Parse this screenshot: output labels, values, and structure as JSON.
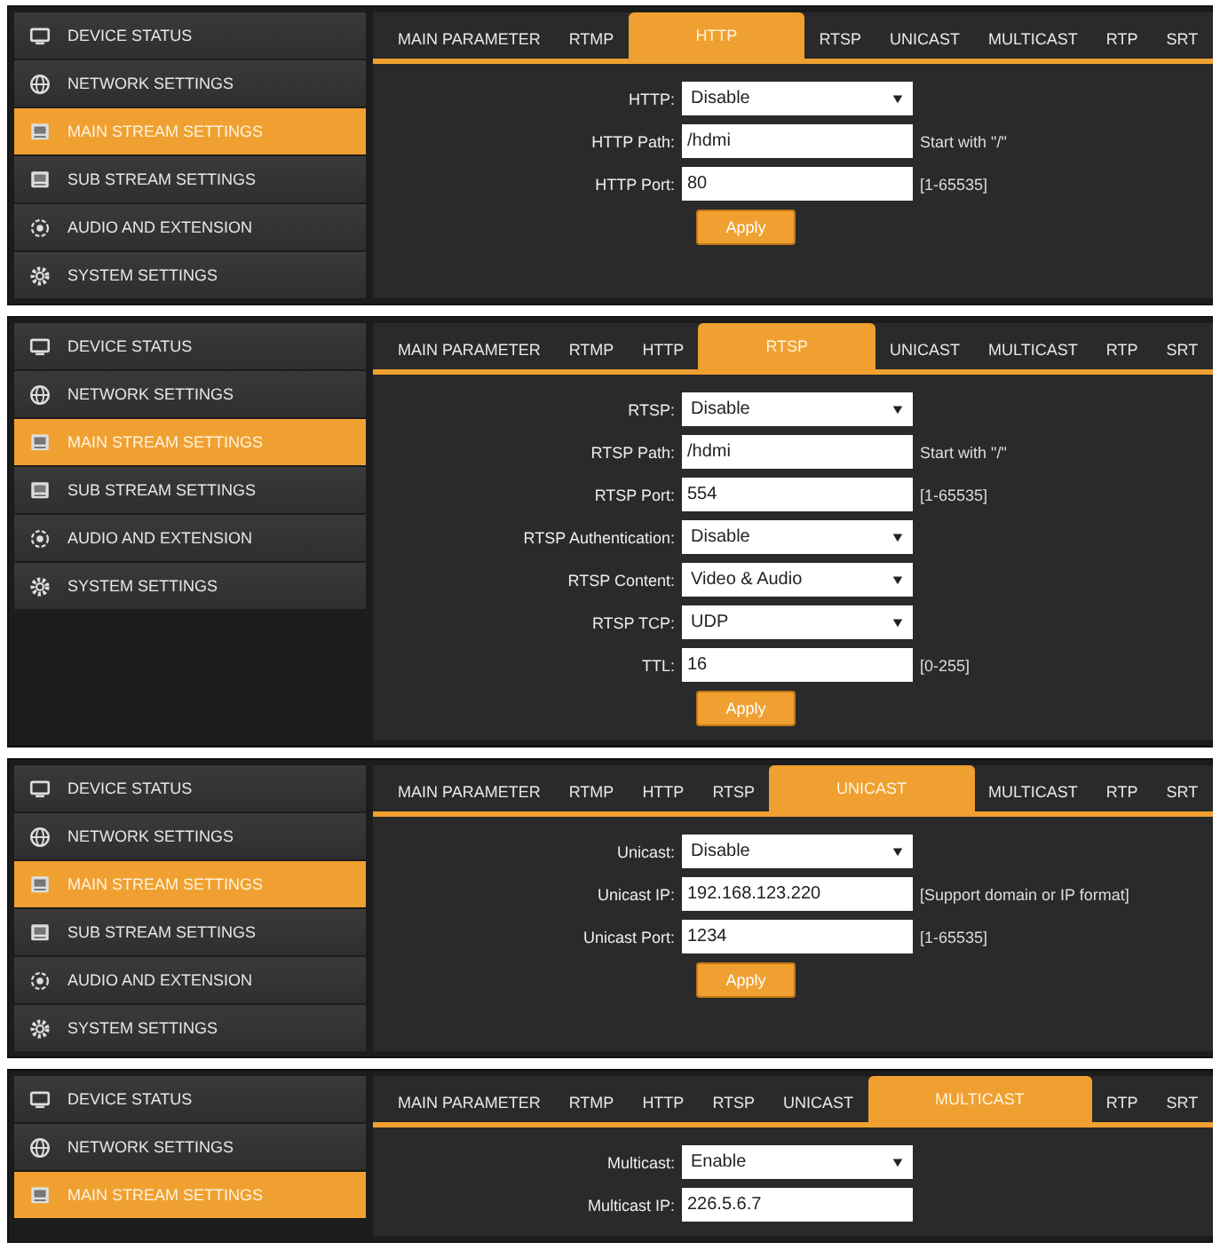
{
  "panels": [
    {
      "sidebar": [
        {
          "label": "DEVICE STATUS",
          "selected": false
        },
        {
          "label": "NETWORK SETTINGS",
          "selected": false
        },
        {
          "label": "MAIN STREAM SETTINGS",
          "selected": true
        },
        {
          "label": "SUB STREAM SETTINGS",
          "selected": false
        },
        {
          "label": "AUDIO AND EXTENSION",
          "selected": false
        },
        {
          "label": "SYSTEM SETTINGS",
          "selected": false
        }
      ],
      "tabs": [
        {
          "label": "MAIN PARAMETER",
          "selected": false
        },
        {
          "label": "RTMP",
          "selected": false
        },
        {
          "label": "HTTP",
          "selected": true
        },
        {
          "label": "RTSP",
          "selected": false
        },
        {
          "label": "UNICAST",
          "selected": false
        },
        {
          "label": "MULTICAST",
          "selected": false
        },
        {
          "label": "RTP",
          "selected": false
        },
        {
          "label": "SRT",
          "selected": false
        }
      ],
      "fields": [
        {
          "label": "HTTP:",
          "kind": "select",
          "value": "Disable"
        },
        {
          "label": "HTTP Path:",
          "kind": "text",
          "value": "/hdmi",
          "hint": "Start with \"/\""
        },
        {
          "label": "HTTP Port:",
          "kind": "text",
          "value": "80",
          "hint": "[1-65535]"
        }
      ],
      "apply_button": "Apply"
    },
    {
      "sidebar": [
        {
          "label": "DEVICE STATUS",
          "selected": false
        },
        {
          "label": "NETWORK SETTINGS",
          "selected": false
        },
        {
          "label": "MAIN STREAM SETTINGS",
          "selected": true
        },
        {
          "label": "SUB STREAM SETTINGS",
          "selected": false
        },
        {
          "label": "AUDIO AND EXTENSION",
          "selected": false
        },
        {
          "label": "SYSTEM SETTINGS",
          "selected": false
        }
      ],
      "tabs": [
        {
          "label": "MAIN PARAMETER",
          "selected": false
        },
        {
          "label": "RTMP",
          "selected": false
        },
        {
          "label": "HTTP",
          "selected": false
        },
        {
          "label": "RTSP",
          "selected": true
        },
        {
          "label": "UNICAST",
          "selected": false
        },
        {
          "label": "MULTICAST",
          "selected": false
        },
        {
          "label": "RTP",
          "selected": false
        },
        {
          "label": "SRT",
          "selected": false
        }
      ],
      "fields": [
        {
          "label": "RTSP:",
          "kind": "select",
          "value": "Disable"
        },
        {
          "label": "RTSP Path:",
          "kind": "text",
          "value": "/hdmi",
          "hint": "Start with \"/\""
        },
        {
          "label": "RTSP Port:",
          "kind": "text",
          "value": "554",
          "hint": "[1-65535]"
        },
        {
          "label": "RTSP Authentication:",
          "kind": "select",
          "value": "Disable"
        },
        {
          "label": "RTSP Content:",
          "kind": "select",
          "value": "Video & Audio"
        },
        {
          "label": "RTSP TCP:",
          "kind": "select",
          "value": "UDP"
        },
        {
          "label": "TTL:",
          "kind": "text",
          "value": "16",
          "hint": "[0-255]"
        }
      ],
      "apply_button": "Apply"
    },
    {
      "sidebar": [
        {
          "label": "DEVICE STATUS",
          "selected": false
        },
        {
          "label": "NETWORK SETTINGS",
          "selected": false
        },
        {
          "label": "MAIN STREAM SETTINGS",
          "selected": true
        },
        {
          "label": "SUB STREAM SETTINGS",
          "selected": false
        },
        {
          "label": "AUDIO AND EXTENSION",
          "selected": false
        },
        {
          "label": "SYSTEM SETTINGS",
          "selected": false
        }
      ],
      "tabs": [
        {
          "label": "MAIN PARAMETER",
          "selected": false
        },
        {
          "label": "RTMP",
          "selected": false
        },
        {
          "label": "HTTP",
          "selected": false
        },
        {
          "label": "RTSP",
          "selected": false
        },
        {
          "label": "UNICAST",
          "selected": true
        },
        {
          "label": "MULTICAST",
          "selected": false
        },
        {
          "label": "RTP",
          "selected": false
        },
        {
          "label": "SRT",
          "selected": false
        }
      ],
      "fields": [
        {
          "label": "Unicast:",
          "kind": "select",
          "value": "Disable"
        },
        {
          "label": "Unicast IP:",
          "kind": "text",
          "value": "192.168.123.220",
          "hint": "[Support domain or IP format]"
        },
        {
          "label": "Unicast Port:",
          "kind": "text",
          "value": "1234",
          "hint": "[1-65535]"
        }
      ],
      "apply_button": "Apply"
    },
    {
      "sidebar": [
        {
          "label": "DEVICE STATUS",
          "selected": false
        },
        {
          "label": "NETWORK SETTINGS",
          "selected": false
        },
        {
          "label": "MAIN STREAM SETTINGS",
          "selected": true
        }
      ],
      "tabs": [
        {
          "label": "MAIN PARAMETER",
          "selected": false
        },
        {
          "label": "RTMP",
          "selected": false
        },
        {
          "label": "HTTP",
          "selected": false
        },
        {
          "label": "RTSP",
          "selected": false
        },
        {
          "label": "UNICAST",
          "selected": false
        },
        {
          "label": "MULTICAST",
          "selected": true
        },
        {
          "label": "RTP",
          "selected": false
        },
        {
          "label": "SRT",
          "selected": false
        }
      ],
      "fields": [
        {
          "label": "Multicast:",
          "kind": "select",
          "value": "Enable"
        },
        {
          "label": "Multicast IP:",
          "kind": "text",
          "value": "226.5.6.7"
        }
      ]
    }
  ]
}
